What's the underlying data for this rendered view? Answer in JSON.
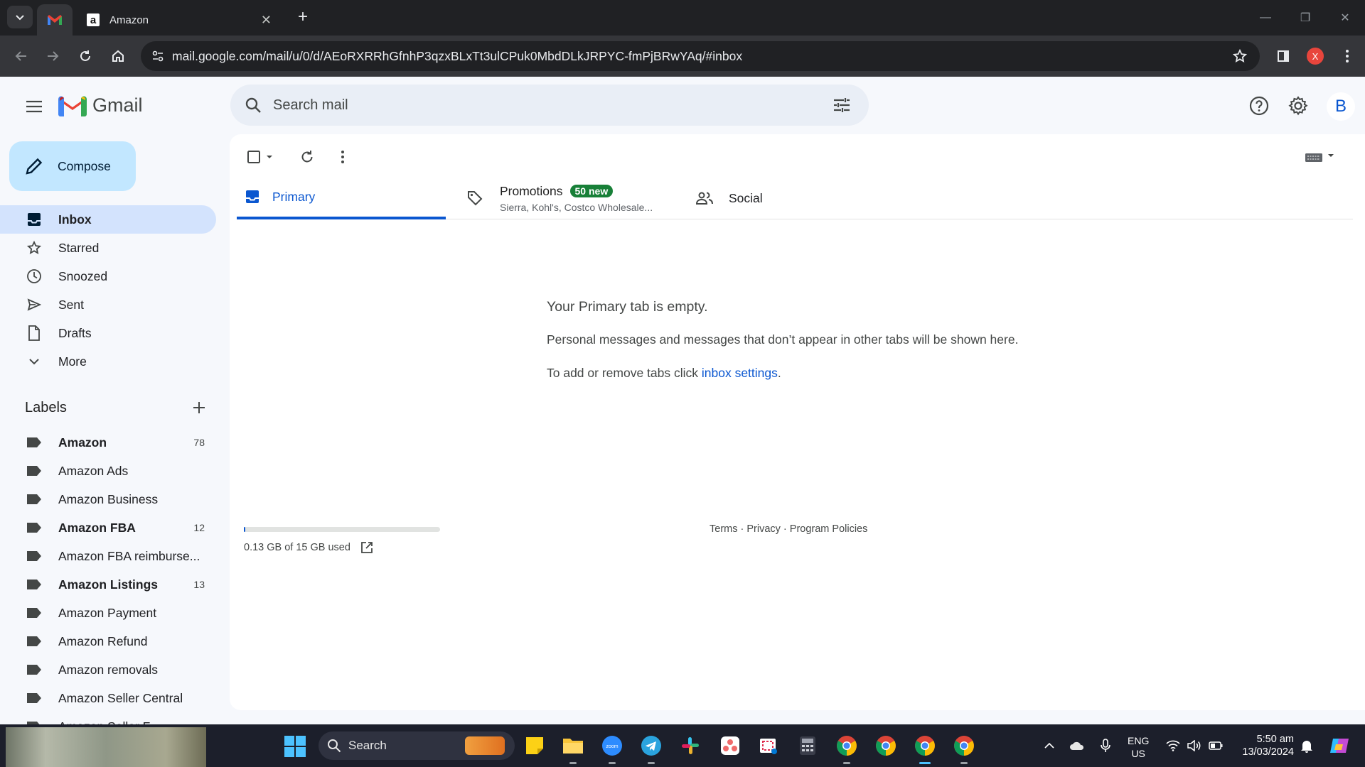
{
  "browser": {
    "tabs": [
      {
        "title": "",
        "icon": "gmail-icon"
      },
      {
        "title": "Amazon",
        "icon": "amazon-icon"
      }
    ],
    "url": "mail.google.com/mail/u/0/d/AEoRXRRhGfnhP3qzxBLxTt3ulCPuk0MbdDLkJRPYC-fmPjBRwYAq/#inbox",
    "profile_badge": "X",
    "favicon_letter": "a"
  },
  "gmail": {
    "logo_text": "Gmail",
    "search_placeholder": "Search mail",
    "avatar_letter": "B",
    "compose_label": "Compose",
    "nav": [
      {
        "label": "Inbox",
        "icon": "inbox-icon",
        "active": true
      },
      {
        "label": "Starred",
        "icon": "star-icon"
      },
      {
        "label": "Snoozed",
        "icon": "clock-icon"
      },
      {
        "label": "Sent",
        "icon": "send-icon"
      },
      {
        "label": "Drafts",
        "icon": "draft-icon"
      },
      {
        "label": "More",
        "icon": "chevron-down-icon"
      }
    ],
    "labels_header": "Labels",
    "labels": [
      {
        "name": "Amazon",
        "count": "78",
        "bold": true
      },
      {
        "name": "Amazon Ads",
        "count": ""
      },
      {
        "name": "Amazon Business",
        "count": ""
      },
      {
        "name": "Amazon FBA",
        "count": "12",
        "bold": true
      },
      {
        "name": "Amazon FBA reimburse...",
        "count": ""
      },
      {
        "name": "Amazon Listings",
        "count": "13",
        "bold": true
      },
      {
        "name": "Amazon Payment",
        "count": ""
      },
      {
        "name": "Amazon Refund",
        "count": ""
      },
      {
        "name": "Amazon removals",
        "count": ""
      },
      {
        "name": "Amazon Seller Central",
        "count": ""
      },
      {
        "name": "Amazon Seller F...",
        "count": ""
      }
    ],
    "tabs": {
      "primary": "Primary",
      "promotions": "Promotions",
      "promotions_badge": "50 new",
      "promotions_sub": "Sierra, Kohl's, Costco Wholesale...",
      "social": "Social"
    },
    "empty": {
      "title": "Your Primary tab is empty.",
      "line1": "Personal messages and messages that don’t appear in other tabs will be shown here.",
      "line2_prefix": "To add or remove tabs click ",
      "line2_link": "inbox settings",
      "line2_suffix": "."
    },
    "storage": {
      "text": "0.13 GB of 15 GB used",
      "used_fraction": 0.0087
    },
    "footer": "Terms · Privacy · Program Policies"
  },
  "taskbar": {
    "search_label": "Search",
    "apps": [
      "sticky-notes-icon",
      "file-explorer-icon",
      "zoom-icon",
      "telegram-icon",
      "slack-icon",
      "asana-icon",
      "snipping-tool-icon",
      "calculator-icon",
      "chrome-icon",
      "chrome-icon",
      "chrome-icon",
      "chrome-icon"
    ],
    "lang_top": "ENG",
    "lang_bottom": "US",
    "time": "5:50 am",
    "date": "13/03/2024"
  },
  "colors": {
    "accent": "#0b57d0",
    "compose_bg": "#c2e7ff",
    "active_nav": "#d3e3fd",
    "badge": "#188038"
  }
}
